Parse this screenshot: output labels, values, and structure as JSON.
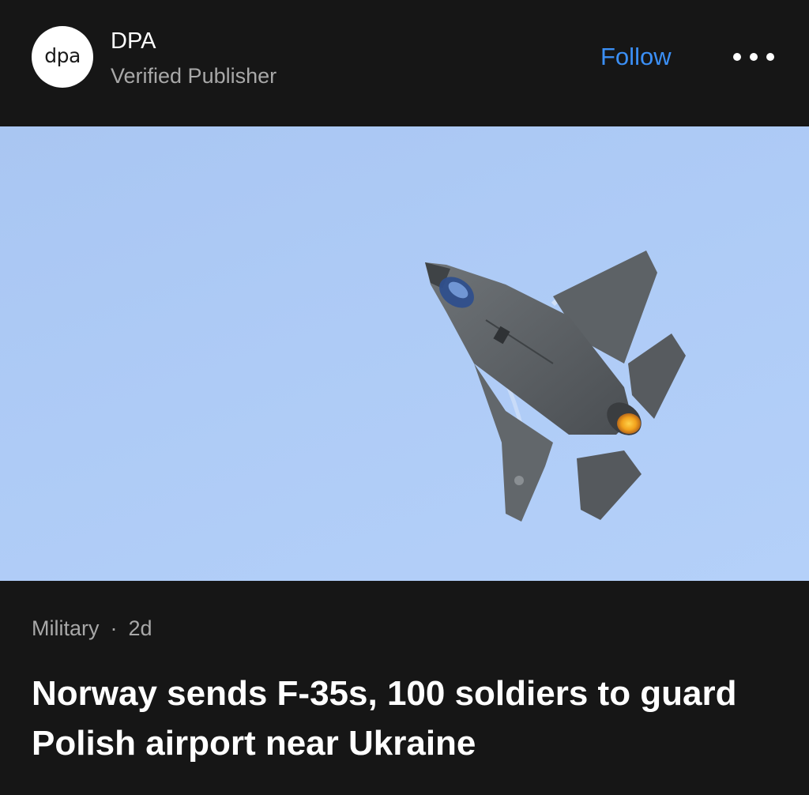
{
  "publisher": {
    "logo_text": "dpa",
    "name": "DPA",
    "subtitle": "Verified Publisher",
    "follow_label": "Follow",
    "more_icon": "ellipsis-horizontal-icon"
  },
  "article": {
    "category": "Military",
    "separator": "·",
    "age": "2d",
    "headline": "Norway sends F-35s, 100 soldiers to guard Polish airport near Ukraine"
  },
  "colors": {
    "background": "#161616",
    "accent": "#3b8ff5",
    "secondary_text": "#a8a8a8",
    "sky": "#aecbf6"
  }
}
